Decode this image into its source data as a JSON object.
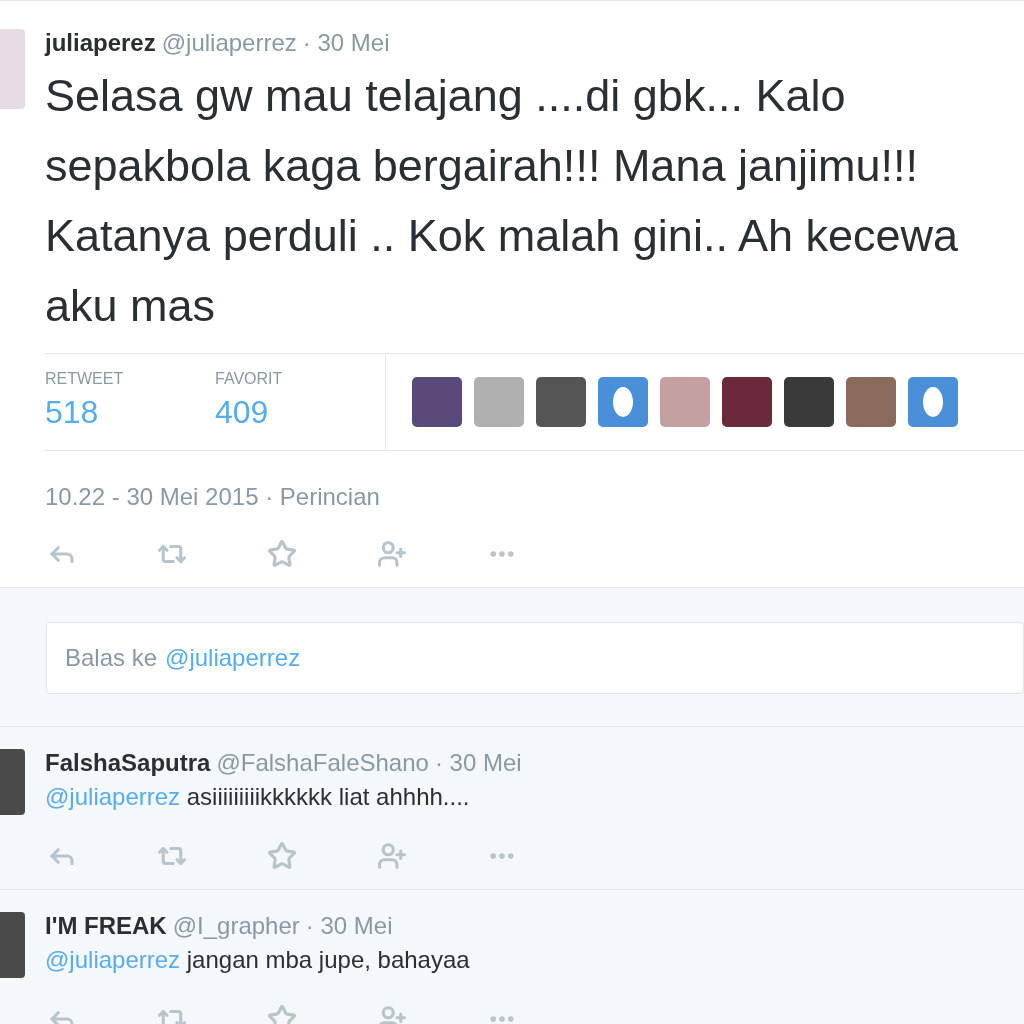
{
  "tweet": {
    "name": "juliaperez",
    "handle": "@juliaperrez",
    "date": "· 30 Mei",
    "text": "Selasa gw mau telajang ....di gbk... Kalo sepakbola kaga bergairah!!! Mana janjimu!!! Katanya perduli .. Kok malah gini.. Ah kecewa aku mas",
    "stats": [
      {
        "label": "RETWEET",
        "value": "518"
      },
      {
        "label": "FAVORIT",
        "value": "409"
      }
    ],
    "favoriters": [
      {
        "kind": "photo"
      },
      {
        "kind": "photo"
      },
      {
        "kind": "photo"
      },
      {
        "kind": "egg"
      },
      {
        "kind": "photo"
      },
      {
        "kind": "photo"
      },
      {
        "kind": "photo"
      },
      {
        "kind": "photo"
      },
      {
        "kind": "egg"
      }
    ],
    "timestamp": "10.22 - 30 Mei 2015",
    "details_link": "· Perincian"
  },
  "reply_box": {
    "prefix": "Balas ke",
    "mention": "@juliaperrez"
  },
  "replies": [
    {
      "name": "FalshaSaputra",
      "handle": "@FalshaFaleShano",
      "date": "· 30 Mei",
      "mention": "@juliaperrez",
      "text": "asiiiiiiiiikkkkkk liat ahhhh...."
    },
    {
      "name": "I'M FREAK",
      "handle": "@I_grapher",
      "date": "· 30 Mei",
      "mention": "@juliaperrez",
      "text": "jangan mba jupe, bahayaa"
    }
  ]
}
